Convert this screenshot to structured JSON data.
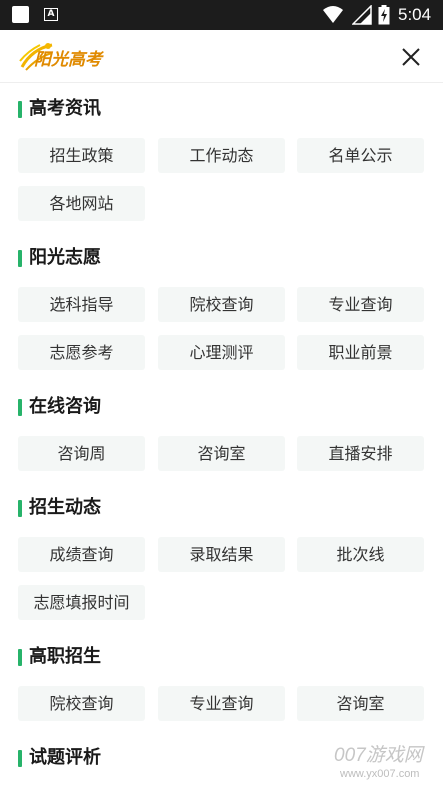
{
  "status_bar": {
    "time": "5:04",
    "icons": [
      "notification-square-icon",
      "a-icon",
      "wifi-icon",
      "signal-icon",
      "battery-charging-icon"
    ]
  },
  "header": {
    "logo_text": "阳光高考",
    "close_icon": "close-icon"
  },
  "sections": [
    {
      "title": "高考资讯",
      "items": [
        "招生政策",
        "工作动态",
        "名单公示",
        "各地网站"
      ]
    },
    {
      "title": "阳光志愿",
      "items": [
        "选科指导",
        "院校查询",
        "专业查询",
        "志愿参考",
        "心理测评",
        "职业前景"
      ]
    },
    {
      "title": "在线咨询",
      "items": [
        "咨询周",
        "咨询室",
        "直播安排"
      ]
    },
    {
      "title": "招生动态",
      "items": [
        "成绩查询",
        "录取结果",
        "批次线",
        "志愿填报时间"
      ]
    },
    {
      "title": "高职招生",
      "items": [
        "院校查询",
        "专业查询",
        "咨询室"
      ]
    },
    {
      "title": "试题评析",
      "items": []
    }
  ],
  "watermark": {
    "main": "007游戏网",
    "sub": "www.yx007.com"
  },
  "colors": {
    "accent": "#27b36a",
    "chip_bg": "#f4f7f6",
    "status_bar": "#1c1c1c",
    "logo": "#e08a00"
  }
}
